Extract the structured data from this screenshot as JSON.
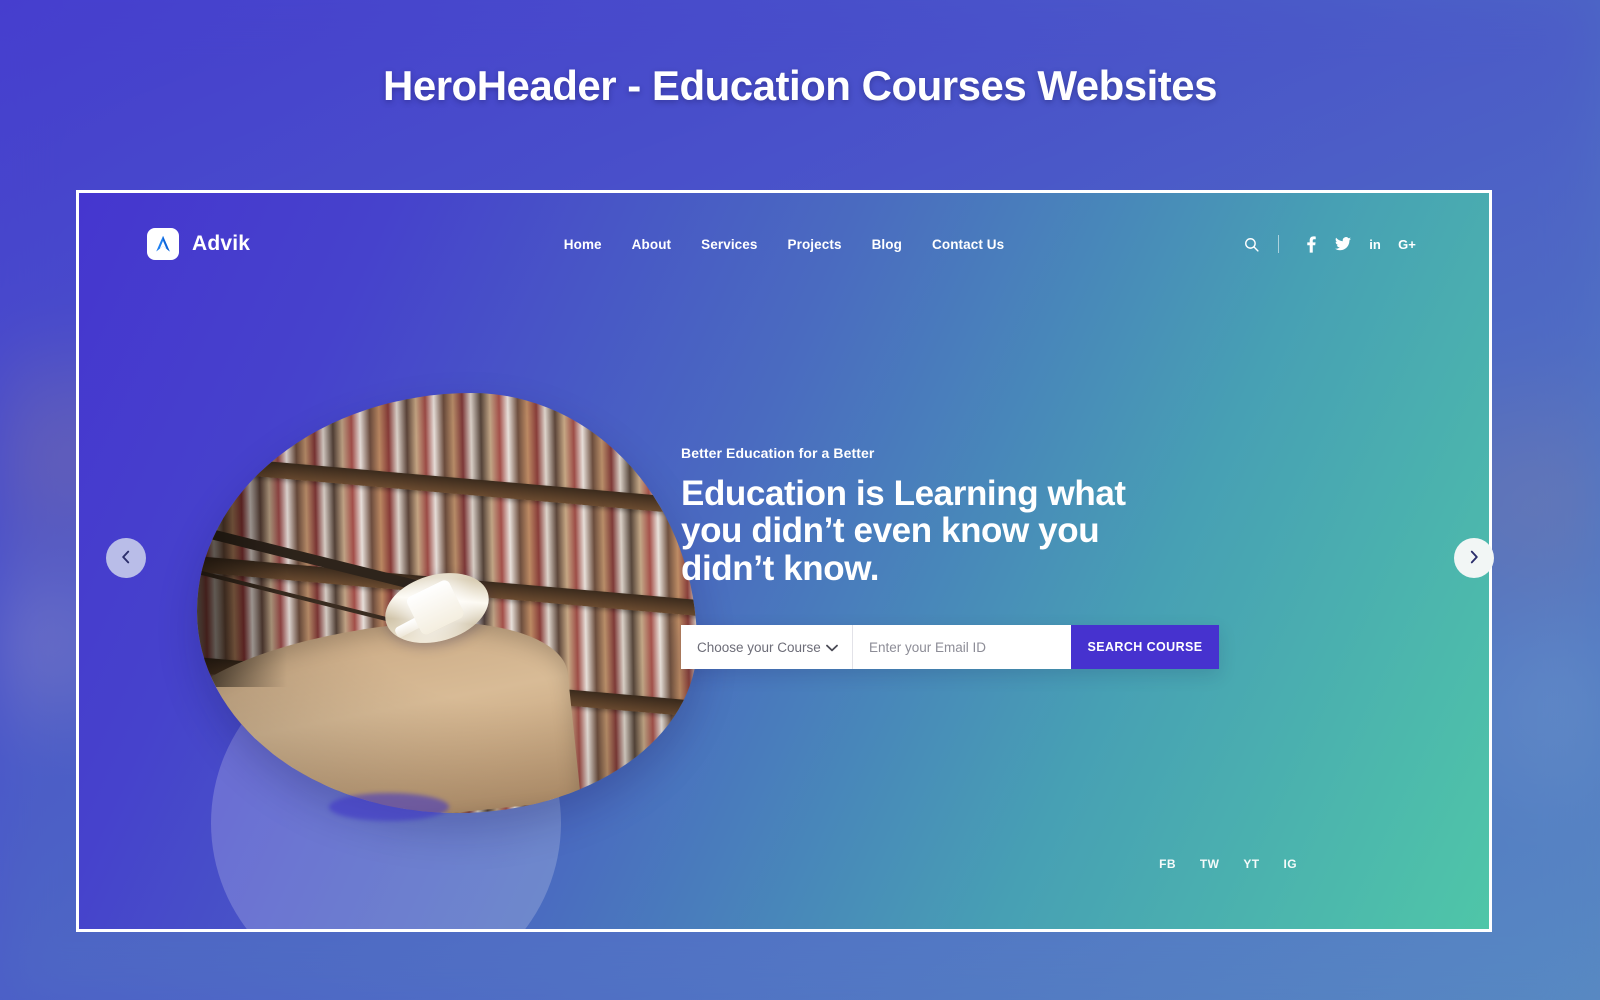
{
  "page": {
    "title": "HeroHeader - Education Courses Websites",
    "accent_color": "#4632cf",
    "hero_gradient_start": "#4536cf",
    "hero_gradient_end": "#4fc6a8",
    "frame_border_color": "#ffffff"
  },
  "navbar": {
    "brand": {
      "name": "Advik",
      "logo_icon": "advik-mountain-logo-icon",
      "logo_bg": "#ffffff",
      "logo_fg": "#1e90ff"
    },
    "links": [
      {
        "label": "Home"
      },
      {
        "label": "About"
      },
      {
        "label": "Services"
      },
      {
        "label": "Projects"
      },
      {
        "label": "Blog"
      },
      {
        "label": "Contact Us"
      }
    ],
    "actions": {
      "search_icon": "search-icon",
      "socials": [
        {
          "name": "facebook",
          "glyph": "f"
        },
        {
          "name": "twitter",
          "glyph": "🐦"
        },
        {
          "name": "linkedin",
          "glyph": "in"
        },
        {
          "name": "google-plus",
          "glyph": "G+"
        }
      ]
    }
  },
  "hero": {
    "eyebrow": "Better Education for a Better",
    "headline": "Education is Learning what you didn’t even know you didn’t know.",
    "photo_alt": "library-bookshelves-photo",
    "lamp_alt": "ceiling-lamp-ellipse-photo"
  },
  "search_form": {
    "course_select": {
      "selected": "Choose your Course",
      "options": [
        "Choose your Course"
      ],
      "chevron_icon": "chevron-down-icon"
    },
    "email": {
      "value": "",
      "placeholder": "Enter your Email ID"
    },
    "submit_label": "SEARCH COURSE",
    "submit_color": "#4632cf"
  },
  "bottom_social": [
    {
      "label": "FB"
    },
    {
      "label": "TW"
    },
    {
      "label": "YT"
    },
    {
      "label": "IG"
    }
  ],
  "carousel": {
    "prev_icon": "chevron-left-icon",
    "next_icon": "chevron-right-icon",
    "prev_bg": "#b9bde8",
    "next_bg": "#f2f6f5"
  }
}
